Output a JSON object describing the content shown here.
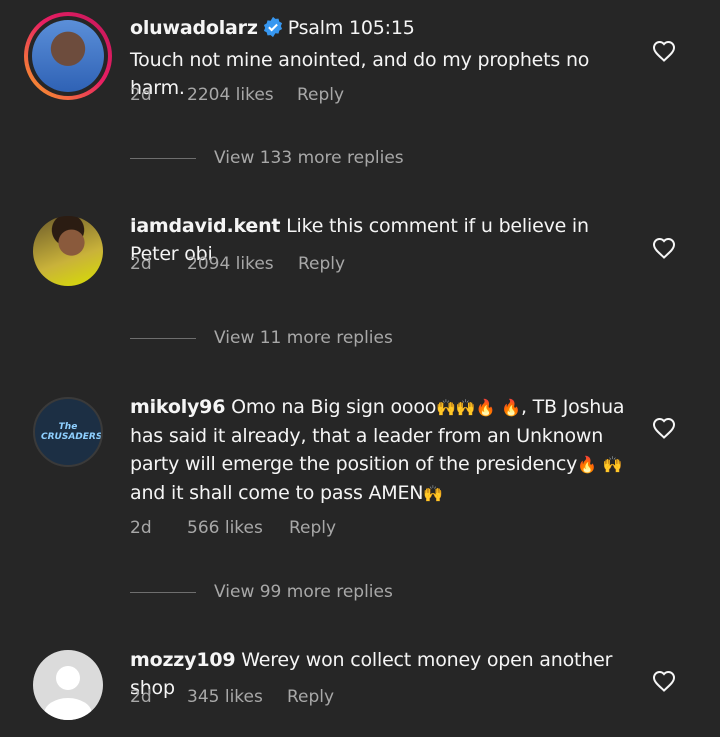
{
  "comments": [
    {
      "username": "oluwadolarz",
      "verified": true,
      "text": "Psalm 105:15\nTouch not mine anointed, and do my prophets no harm.",
      "time": "2d",
      "likes": "2204 likes",
      "reply": "Reply",
      "view_more": "View 133 more replies"
    },
    {
      "username": "iamdavid.kent",
      "text": "Like this comment if u believe in Peter obi",
      "time": "2d",
      "likes": "2094 likes",
      "reply": "Reply",
      "view_more": "View 11 more replies"
    },
    {
      "username": "mikoly96",
      "text_parts": [
        "Omo na Big sign oooo",
        "🙌🙌",
        "🔥",
        "🔥",
        ", TB Joshua has said it already, that a leader from an Unknown party will emerge the position of the presidency",
        "🔥",
        "🙌",
        " and it shall come to pass AMEN",
        "🙌"
      ],
      "avatar_text": "The CRUSADERS",
      "time": "2d",
      "likes": "566 likes",
      "reply": "Reply",
      "view_more": "View 99 more replies"
    },
    {
      "username": "mozzy109",
      "text": "Werey won collect money open another shop",
      "time": "2d",
      "likes": "345 likes",
      "reply": "Reply"
    }
  ],
  "icons": [
    "verified-badge-icon",
    "heart-icon"
  ],
  "colors": {
    "background": "#262626",
    "text": "#f5f5f5",
    "secondary": "#a8a8a8",
    "verified": "#3797f0"
  }
}
